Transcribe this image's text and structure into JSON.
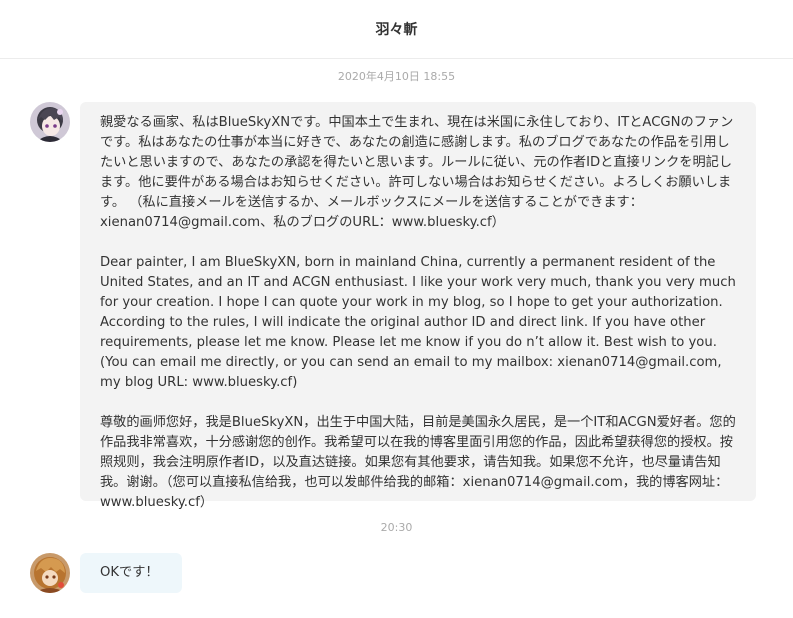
{
  "header": {
    "title": "羽々斬"
  },
  "messages": [
    {
      "timestamp": "2020年4月10日 18:55",
      "avatar_icon": "anime-girl-avatar-icon",
      "paragraphs": [
        "親愛なる画家、私はBlueSkyXNです。中国本土で生まれ、現在は米国に永住しており、ITとACGNのファンです。私はあなたの仕事が本当に好きで、あなたの創造に感謝します。私のブログであなたの作品を引用したいと思いますので、あなたの承認を得たいと思います。ルールに従い、元の作者IDと直接リンクを明記します。他に要件がある場合はお知らせください。許可しない場合はお知らせください。よろしくお願いします。 （私に直接メールを送信するか、メールボックスにメールを送信することができます：xienan0714@gmail.com、私のブログのURL：www.bluesky.cf）",
        "Dear painter, I am BlueSkyXN, born in mainland China, currently a permanent resident of the United States, and an IT and ACGN enthusiast. I like your work very much, thank you very much for your creation. I hope I can quote your work in my blog, so I hope to get your authorization. According to the rules, I will indicate the original author ID and direct link. If you have other requirements, please let me know. Please let me know if you do n’t allow it. Best wish to you. (You can email me directly, or you can send an email to my mailbox: xienan0714@gmail.com, my blog URL: www.bluesky.cf)",
        "尊敬的画师您好，我是BlueSkyXN，出生于中国大陆，目前是美国永久居民，是一个IT和ACGN爱好者。您的作品我非常喜欢，十分感谢您的创作。我希望可以在我的博客里面引用您的作品，因此希望获得您的授权。按照规则，我会注明原作者ID，以及直达链接。如果您有其他要求，请告知我。如果您不允许，也尽量请告知我。谢谢。（您可以直接私信给我，也可以发邮件给我的邮箱：xienan0714@gmail.com，我的博客网址：www.bluesky.cf）"
      ]
    },
    {
      "timestamp": "20:30",
      "avatar_icon": "anime-character-avatar-icon",
      "text": "OKです！"
    }
  ],
  "colors": {
    "bubble_gray": "#f3f3f3",
    "bubble_reply": "#eef7fb",
    "timestamp": "#aaaaaa",
    "divider": "#ececec"
  }
}
